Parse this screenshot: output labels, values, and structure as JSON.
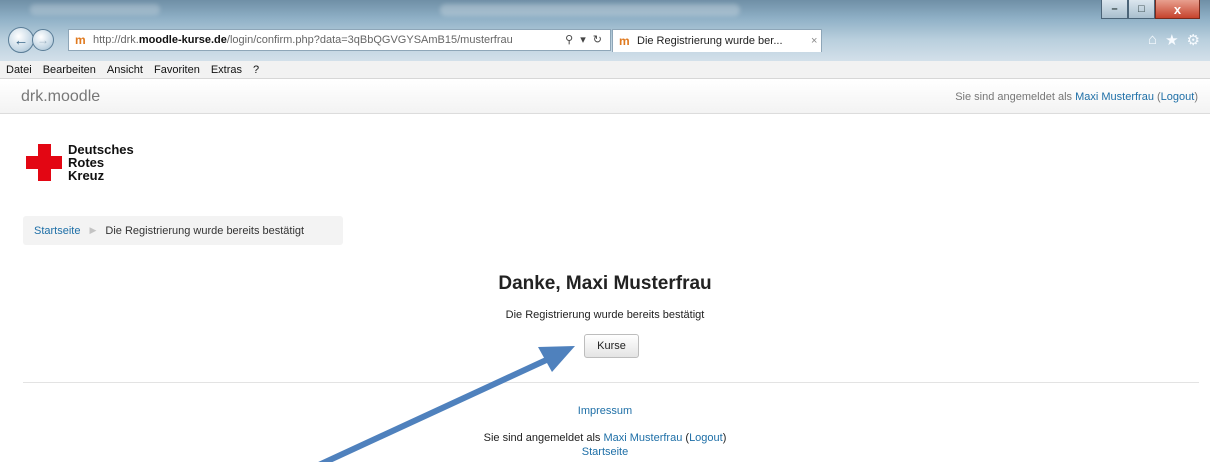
{
  "browser": {
    "address_domain": "drk.moodle-kurse.de",
    "address_prefix": "http://drk.",
    "address_domain_bold": "moodle-kurse.de",
    "address_path": "/login/confirm.php?data=3qBbQGVGYSAmB15/musterfrau",
    "tab_title": "Die Registrierung wurde ber...",
    "tab_close": "×",
    "window_controls": [
      "–",
      "□",
      "x"
    ],
    "right_tools": [
      "⌂",
      "★",
      "⚙"
    ]
  },
  "menubar": [
    "Datei",
    "Bearbeiten",
    "Ansicht",
    "Favoriten",
    "Extras",
    "?"
  ],
  "navbar": {
    "brand": "drk.moodle",
    "login_prefix": "Sie sind angemeldet als ",
    "user_name": "Maxi Musterfrau",
    "logout": "Logout"
  },
  "logo": {
    "lines": [
      "Deutsches",
      "Rotes",
      "Kreuz"
    ],
    "color": "#e30613"
  },
  "breadcrumb": {
    "home": "Startseite",
    "current": "Die Registrierung wurde bereits bestätigt"
  },
  "main": {
    "title": "Danke, Maxi Musterfrau",
    "message": "Die Registrierung wurde bereits bestätigt",
    "button_label": "Kurse"
  },
  "footer": {
    "impressum": "Impressum",
    "login_prefix": "Sie sind angemeldet als ",
    "user_name": "Maxi Musterfrau",
    "logout": "Logout",
    "home": "Startseite"
  },
  "colors": {
    "link": "#1e6fa7",
    "arrow": "#4f81bd"
  }
}
